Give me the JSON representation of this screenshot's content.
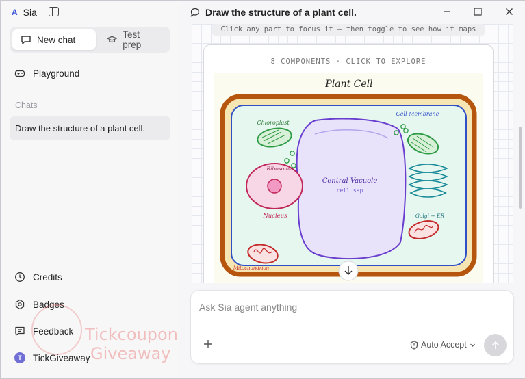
{
  "app": {
    "logo": "A",
    "name": "Sia"
  },
  "modes": {
    "new_chat": "New chat",
    "test_prep": "Test prep"
  },
  "nav": {
    "playground": "Playground"
  },
  "chats": {
    "label": "Chats",
    "items": [
      "Draw the structure of a plant cell."
    ]
  },
  "bottom_nav": {
    "credits": "Credits",
    "badges": "Badges",
    "feedback": "Feedback",
    "user": "TickGiveaway",
    "user_initial": "T"
  },
  "watermark": {
    "line1": "Tickcoupon",
    "line2": "Giveaway"
  },
  "main": {
    "title": "Draw the structure of a plant cell.",
    "hint": "Click any part to focus it — then toggle to see how it maps",
    "components_label": "8 COMPONENTS · CLICK TO EXPLORE"
  },
  "diagram": {
    "title": "Plant Cell",
    "labels": {
      "chloroplast": "Chloroplast",
      "cell_membrane": "Cell Membrane",
      "ribosomes": "Ribosomes",
      "central_vacuole": "Central Vacuole",
      "cell_sap": "cell sap",
      "nucleus": "Nucleus",
      "golgi_er": "Golgi + ER",
      "mitochondrion": "Mitochondrion"
    },
    "colors": {
      "cell_wall": "#b5550e",
      "membrane": "#2f4fc7",
      "cytoplasm": "#e6f7ef",
      "vacuole": "#e8e2fb",
      "vacuole_stroke": "#6a3fcf",
      "nucleus": "#f7d6e6",
      "nucleus_stroke": "#c0285a",
      "chloroplast": "#2e9b46",
      "golgi": "#1a8a9a",
      "mitochondrion": "#c42a2a"
    }
  },
  "composer": {
    "placeholder": "Ask Sia agent anything",
    "auto_accept": "Auto Accept"
  }
}
